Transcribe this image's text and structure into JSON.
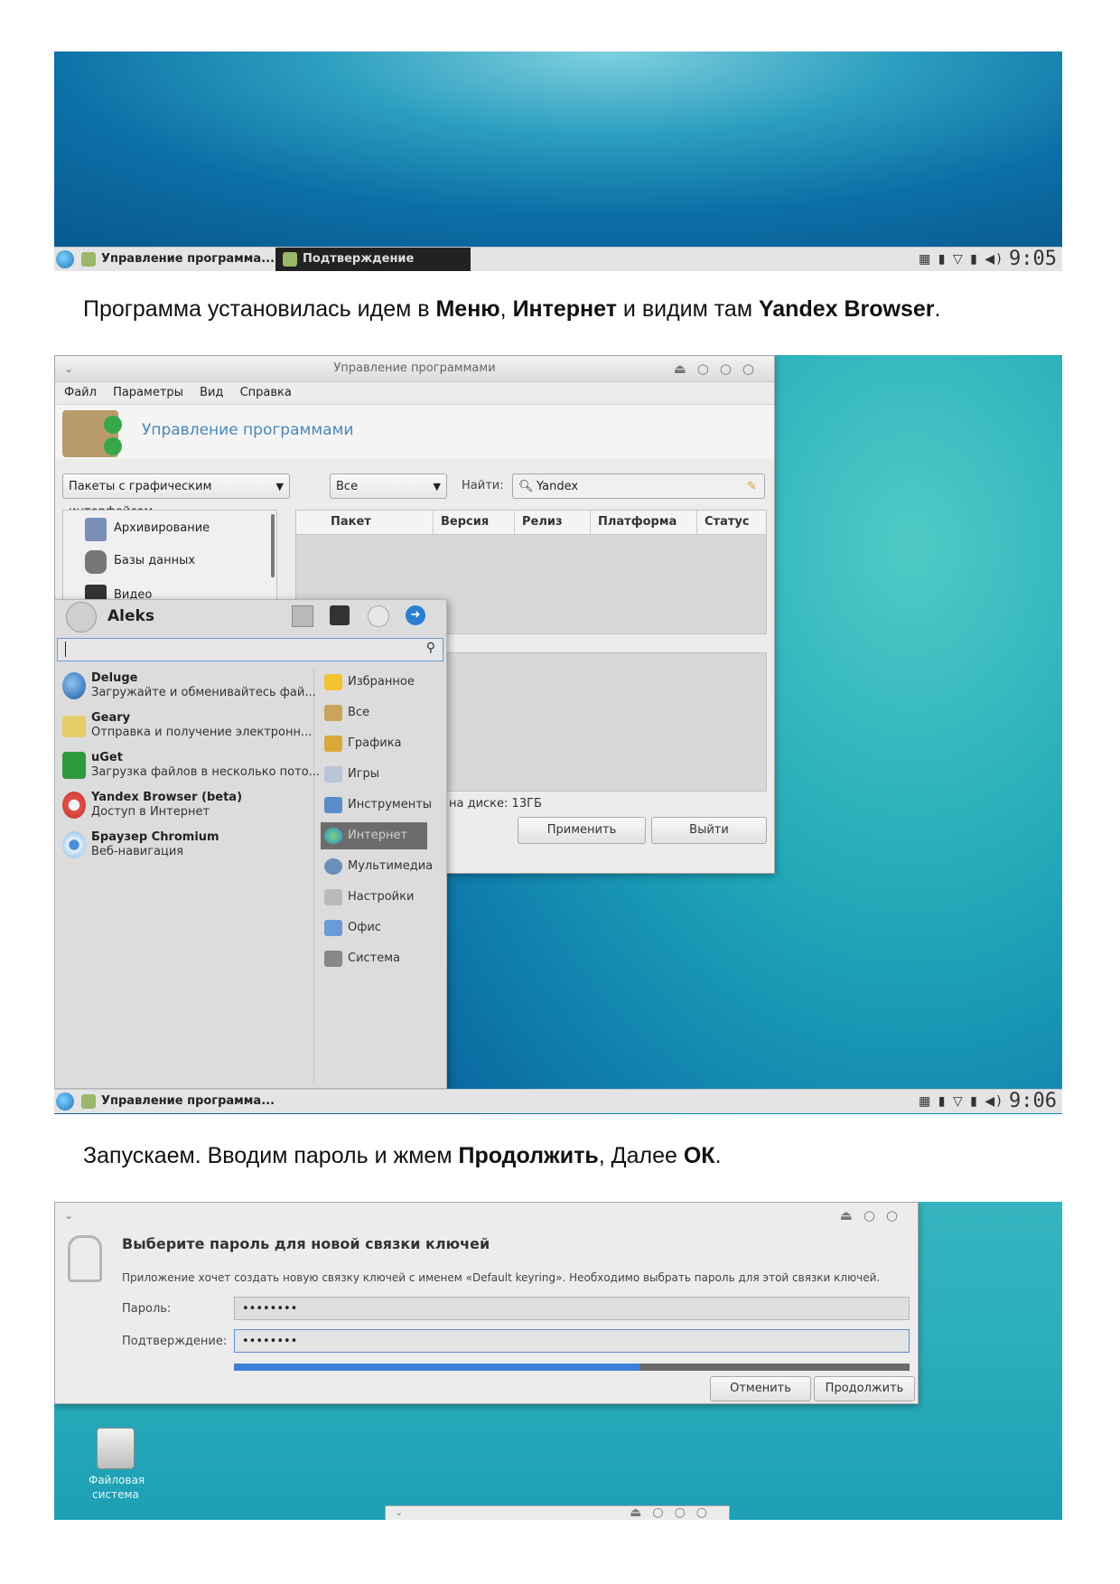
{
  "shot1": {
    "taskbar": {
      "task1": "Управление программа...",
      "task2": "Подтверждение",
      "tray_icons": "▦ ▮ ▽ ▮ ◀)",
      "clock": "9:05"
    }
  },
  "caption1": {
    "p1": "Программа установилась идем в ",
    "b1": "Меню",
    "p2": ", ",
    "b2": "Интернет",
    "p3": " и видим там ",
    "b3": "Yandex Browser",
    "p4": "."
  },
  "shot2": {
    "window": {
      "title": "Управление программами",
      "menu": [
        "Файл",
        "Параметры",
        "Вид",
        "Справка"
      ],
      "header": "Управление программами",
      "filter1": "Пакеты с графическим интерфейсом",
      "filter2": "Все",
      "find_label": "Найти:",
      "find_value": "Yandex",
      "categories": [
        "Архивирование",
        "Базы данных",
        "Видео"
      ],
      "columns": [
        "Пакет",
        "Версия",
        "Релиз",
        "Платформа",
        "Статус"
      ],
      "disk": "на диске: 13ГБ",
      "apply": "Применить",
      "quit": "Выйти"
    },
    "start_menu": {
      "user": "Aleks",
      "apps": [
        {
          "name": "Deluge",
          "desc": "Загружайте и обменивайтесь фай..."
        },
        {
          "name": "Geary",
          "desc": "Отправка и получение электронн..."
        },
        {
          "name": "uGet",
          "desc": "Загрузка файлов в несколько пото..."
        },
        {
          "name": "Yandex Browser (beta)",
          "desc": "Доступ в Интернет"
        },
        {
          "name": "Браузер Chromium",
          "desc": "Веб-навигация"
        }
      ],
      "categories": [
        "Избранное",
        "Все",
        "Графика",
        "Игры",
        "Инструменты",
        "Интернет",
        "Мультимедиа",
        "Настройки",
        "Офис",
        "Система"
      ]
    },
    "taskbar": {
      "task1": "Управление программа...",
      "tray_icons": "▦ ▮ ▽ ▮ ◀)",
      "clock": "9:06"
    }
  },
  "caption2": {
    "p1": "Запускаем. Вводим пароль и жмем ",
    "b1": "Продолжить",
    "p2": ", Далее ",
    "b2": "ОК",
    "p3": "."
  },
  "shot3": {
    "dialog": {
      "heading": "Выберите пароль для новой связки ключей",
      "message": "Приложение хочет создать новую связку ключей с именем «Default keyring». Необходимо выбрать пароль для этой связки ключей.",
      "password_label": "Пароль:",
      "password_value": "••••••••",
      "confirm_label": "Подтверждение:",
      "confirm_value": "••••••••",
      "strength": 0.6,
      "cancel": "Отменить",
      "continue": "Продолжить"
    },
    "desktop_icon": "Файловая система"
  },
  "colors": {
    "accent": "#3d7fd6",
    "selected_category": "#6c6c6c"
  }
}
